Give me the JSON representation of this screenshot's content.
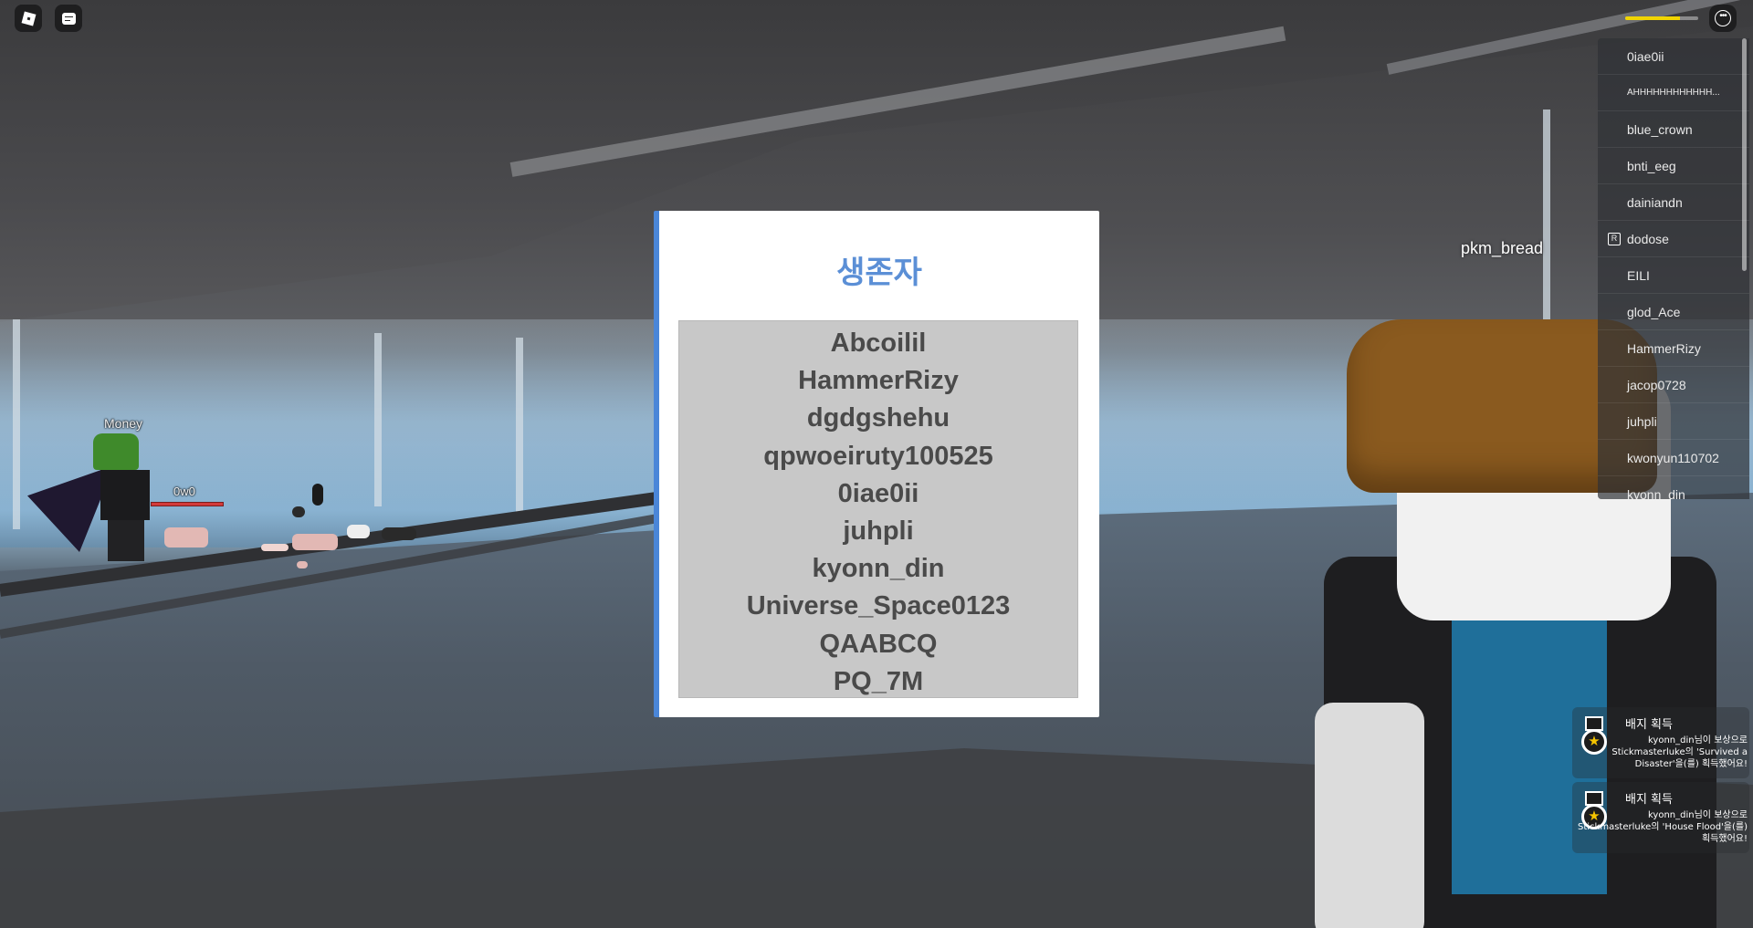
{
  "hud": {
    "health_percent": 75,
    "health_color": "#f1d500",
    "menu_button_icon": "more-icon",
    "roblox_button_icon": "roblox-logo-icon",
    "chat_button_icon": "chat-icon"
  },
  "playerlist": {
    "players": [
      "0iae0ii",
      "AHHHHHHHHHHHH...",
      "blue_crown",
      "bnti_eeg",
      "dainiandn",
      "dodose",
      "EILI",
      "glod_Ace",
      "HammerRizy",
      "jacop0728",
      "juhpli",
      "kwonyun110702",
      "kyonn_din"
    ],
    "premium_player_index": 5
  },
  "world_labels": {
    "nametag": "pkm_bread",
    "small_char_name": "Money",
    "small_char_tag": "0w0"
  },
  "modal": {
    "title": "생존자",
    "accent_color": "#4a86d8",
    "survivors": [
      "Abcoilil",
      "HammerRizy",
      "dgdgshehu",
      "qpwoeiruty100525",
      "0iae0ii",
      "juhpli",
      "kyonn_din",
      "Universe_Space0123",
      "QAABCQ",
      "PQ_7M"
    ]
  },
  "notifications": [
    {
      "title": "배지 획득",
      "text": "kyonn_din님이 보상으로 Stickmasterluke의 'Survived a Disaster'을(를) 획득했어요!",
      "icon": "badge-medal-icon"
    },
    {
      "title": "배지 획득",
      "text": "kyonn_din님이 보상으로 Stickmasterluke의 'House Flood'을(를) 획득했어요!",
      "icon": "badge-medal-icon"
    }
  ]
}
